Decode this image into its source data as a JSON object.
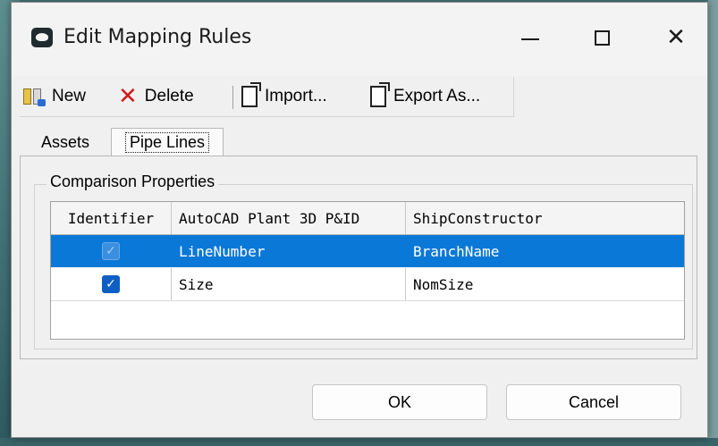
{
  "window": {
    "title": "Edit Mapping Rules",
    "app_icon": "app-logo-icon",
    "controls": {
      "minimize": "—",
      "maximize": "☐",
      "close": "✕"
    }
  },
  "toolbar": {
    "new_label": "New",
    "delete_label": "Delete",
    "import_label": "Import...",
    "export_label": "Export As..."
  },
  "tabs": [
    {
      "label": "Assets",
      "active": false
    },
    {
      "label": "Pipe Lines",
      "active": true
    }
  ],
  "group": {
    "title": "Comparison Properties"
  },
  "grid": {
    "headers": [
      "Identifier",
      "AutoCAD Plant 3D P&ID",
      "ShipConstructor"
    ],
    "rows": [
      {
        "identifier": true,
        "source": "LineNumber",
        "target": "BranchName",
        "selected": true
      },
      {
        "identifier": true,
        "source": "Size",
        "target": "NomSize",
        "selected": false
      }
    ]
  },
  "buttons": {
    "ok": "OK",
    "cancel": "Cancel"
  },
  "colors": {
    "selection": "#0a78d7",
    "checkbox": "#0d5fc4",
    "delete_icon": "#d11a1a"
  }
}
